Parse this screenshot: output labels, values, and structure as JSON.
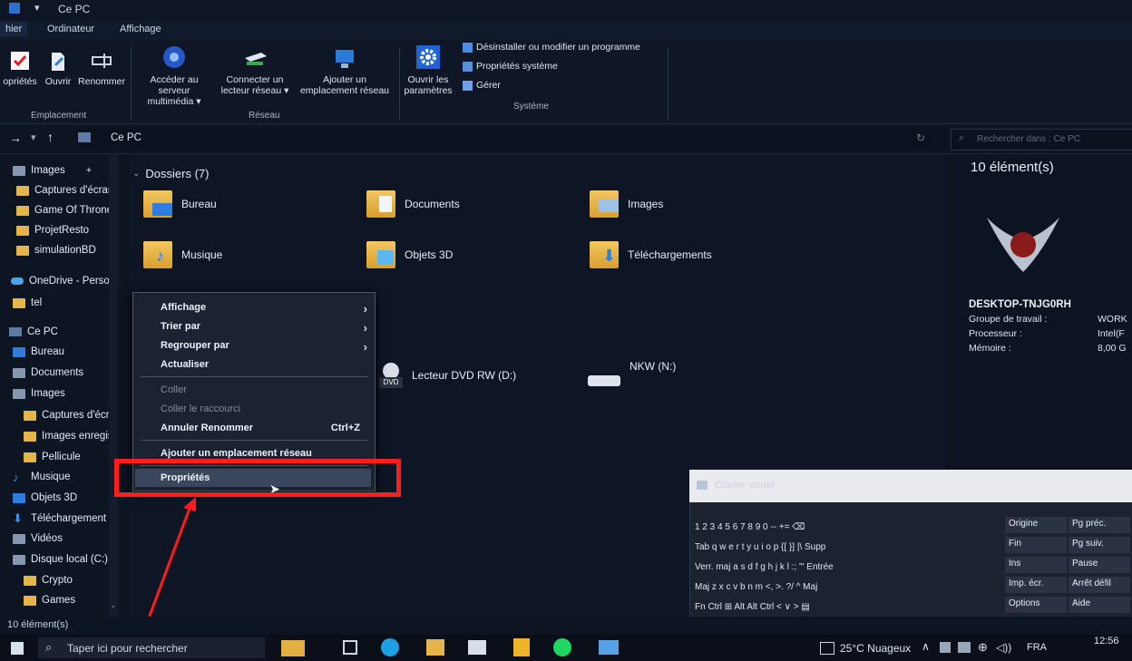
{
  "window": {
    "title": "Ce PC"
  },
  "tabs": [
    "hier",
    "Ordinateur",
    "Affichage"
  ],
  "ribbon": {
    "emplacement": {
      "buttons": [
        "opriétés",
        "Ouvrir",
        "Renommer"
      ],
      "label": "Emplacement"
    },
    "reseau": {
      "buttons": [
        "Accéder au serveur multimédia ▾",
        "Connecter un lecteur réseau ▾",
        "Ajouter un emplacement réseau"
      ],
      "label": "Réseau"
    },
    "systeme": {
      "open_settings": "Ouvrir les paramètres",
      "uninstall": "Désinstaller ou modifier un programme",
      "system_props": "Propriétés système",
      "manage": "Gérer",
      "label": "Système"
    }
  },
  "address": {
    "path": "Ce PC",
    "search_placeholder": "Rechercher dans : Ce PC"
  },
  "nav": {
    "items": [
      "Images",
      "Captures d'écrar",
      "Game Of Throne",
      "ProjetResto",
      "simulationBD",
      "OneDrive - Persor",
      "tel",
      "Ce PC",
      "Bureau",
      "Documents",
      "Images",
      "Captures d'écra",
      "Images enregis",
      "Pellicule",
      "Musique",
      "Objets 3D",
      "Téléchargement",
      "Vidéos",
      "Disque local (C:)",
      "Crypto",
      "Games"
    ]
  },
  "content": {
    "section_title": "Dossiers (7)",
    "folders": [
      "Bureau",
      "Documents",
      "Images",
      "Musique",
      "Objets 3D",
      "Téléchargements"
    ],
    "drives": [
      "Lecteur DVD RW (D:)",
      "NKW (N:)"
    ],
    "dvd_badge": "DVD"
  },
  "details": {
    "count": "10 élément(s)",
    "computer_name": "DESKTOP-TNJG0RH",
    "rows": [
      {
        "label": "Groupe de travail :",
        "value": "WORK"
      },
      {
        "label": "Processeur :",
        "value": "Intel(F"
      },
      {
        "label": "Mémoire :",
        "value": "8,00 G"
      }
    ]
  },
  "context_menu": {
    "items": [
      {
        "label": "Affichage",
        "submenu": true
      },
      {
        "label": "Trier par",
        "submenu": true
      },
      {
        "label": "Regrouper par",
        "submenu": true
      },
      {
        "label": "Actualiser"
      },
      {
        "label": "Coller",
        "disabled": true
      },
      {
        "label": "Coller le raccourci",
        "disabled": true
      },
      {
        "label": "Annuler Renommer",
        "shortcut": "Ctrl+Z"
      },
      {
        "label": "Ajouter un emplacement réseau"
      },
      {
        "label": "Propriétés"
      }
    ]
  },
  "status": {
    "text": "10 élément(s)"
  },
  "taskbar": {
    "search_placeholder": "Taper ici pour rechercher",
    "weather": "25°C Nuageux",
    "lang": "FRA",
    "time": "12:56"
  },
  "keyboard": {
    "title": "Clavier visuel",
    "rows": [
      "1  2  3  4  5  6  7  8  9  0  --  +=  ⌫",
      "Tab  q  w  e  r  t  y  u  i  o  p  {[  }]  |\\  Supp",
      "Verr. maj  a  s  d  f  g  h  j  k  l  :;  \"'  Entrée",
      "Maj  z  x  c  v  b  n  m  <,  >.  ?/  ^  Maj",
      "Fn  Ctrl  ⊞  Alt                     Alt  Ctrl  <  ∨  >  ▤"
    ],
    "side_keys": [
      "Origine",
      "Pg préc.",
      "Fin",
      "Pg suiv.",
      "Ins",
      "Pause",
      "Imp. écr.",
      "Arrêt défil",
      "Options",
      "Aide"
    ]
  },
  "colors": {
    "accent": "#2f7de0",
    "highlight_border": "#ff1d1d",
    "folder": "#e6b54a"
  }
}
